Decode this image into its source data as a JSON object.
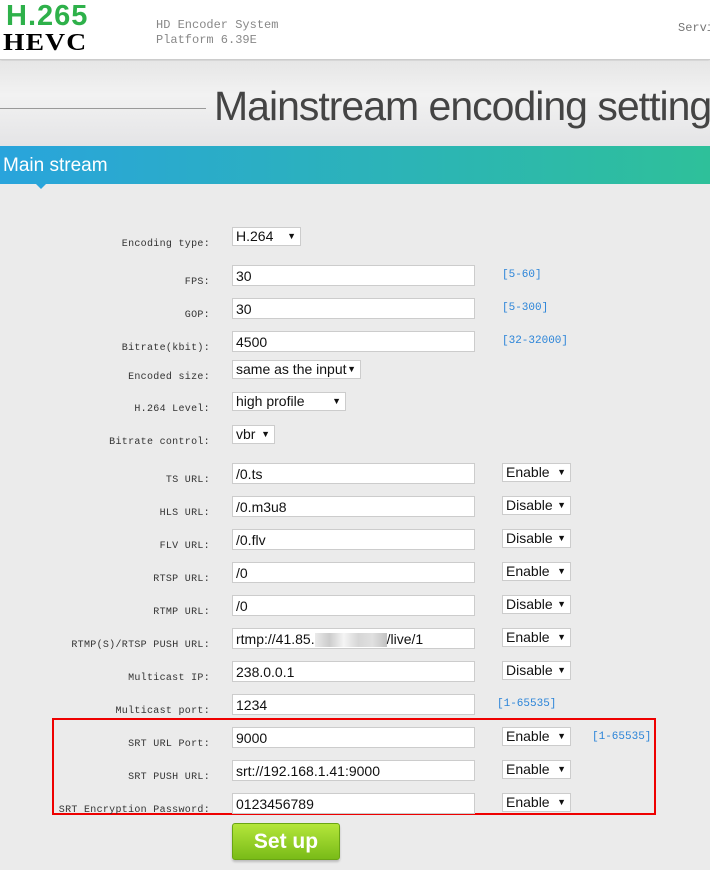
{
  "header": {
    "logo_top": "H.265",
    "logo_bottom": "HEVC",
    "system_line1": "HD Encoder System",
    "system_line2": "Platform 6.39E",
    "nav_partial": "Servi"
  },
  "page_title": "Mainstream encoding settings",
  "section_title": "Main stream",
  "form": {
    "encoding_type": {
      "label": "Encoding type:",
      "value": "H.264"
    },
    "fps": {
      "label": "FPS:",
      "value": "30",
      "hint": "[5-60]"
    },
    "gop": {
      "label": "GOP:",
      "value": "30",
      "hint": "[5-300]"
    },
    "bitrate": {
      "label": "Bitrate(kbit):",
      "value": "4500",
      "hint": "[32-32000]"
    },
    "encoded_size": {
      "label": "Encoded size:",
      "value": "same as the input"
    },
    "h264_level": {
      "label": "H.264 Level:",
      "value": "high profile"
    },
    "bitrate_control": {
      "label": "Bitrate control:",
      "value": "vbr"
    },
    "ts_url": {
      "label": "TS URL:",
      "value": "/0.ts",
      "state": "Enable"
    },
    "hls_url": {
      "label": "HLS URL:",
      "value": "/0.m3u8",
      "state": "Disable"
    },
    "flv_url": {
      "label": "FLV URL:",
      "value": "/0.flv",
      "state": "Disable"
    },
    "rtsp_url": {
      "label": "RTSP URL:",
      "value": "/0",
      "state": "Enable"
    },
    "rtmp_url": {
      "label": "RTMP URL:",
      "value": "/0",
      "state": "Disable"
    },
    "push_url": {
      "label": "RTMP(S)/RTSP PUSH URL:",
      "value_prefix": "rtmp://41.85.",
      "value_suffix": "/live/1",
      "state": "Enable"
    },
    "multicast_ip": {
      "label": "Multicast IP:",
      "value": "238.0.0.1",
      "state": "Disable"
    },
    "multicast_port": {
      "label": "Multicast port:",
      "value": "1234",
      "hint": "[1-65535]"
    },
    "srt_port": {
      "label": "SRT URL Port:",
      "value": "9000",
      "state": "Enable",
      "hint": "[1-65535]"
    },
    "srt_push": {
      "label": "SRT PUSH URL:",
      "value": "srt://192.168.1.41:9000",
      "state": "Enable"
    },
    "srt_password": {
      "label": "SRT Encryption Password:",
      "value": "0123456789",
      "state": "Enable"
    }
  },
  "submit_label": "Set up",
  "colors": {
    "accent_start": "#29a4dc",
    "accent_end": "#2ec09a",
    "hint": "#2b84d8",
    "highlight_box": "#ee0000",
    "button": "#8cc826"
  }
}
